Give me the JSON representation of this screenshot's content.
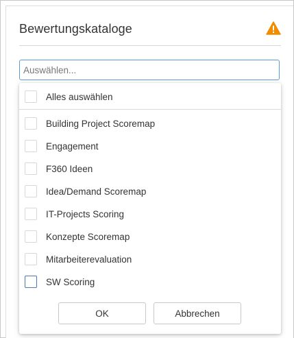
{
  "header": {
    "title": "Bewertungskataloge",
    "warning_icon": "warning-icon",
    "warning_color": "#f08c00"
  },
  "select": {
    "placeholder": "Auswählen...",
    "border_color": "#5b9bd5"
  },
  "dropdown": {
    "select_all_label": "Alles auswählen",
    "items": [
      {
        "label": "Building Project Scoremap"
      },
      {
        "label": "Engagement"
      },
      {
        "label": "F360 Ideen"
      },
      {
        "label": "Idea/Demand Scoremap"
      },
      {
        "label": "IT-Projects Scoring"
      },
      {
        "label": "Konzepte Scoremap"
      },
      {
        "label": "Mitarbeiterevaluation"
      },
      {
        "label": "SW Scoring"
      }
    ],
    "ok_label": "OK",
    "cancel_label": "Abbrechen"
  }
}
